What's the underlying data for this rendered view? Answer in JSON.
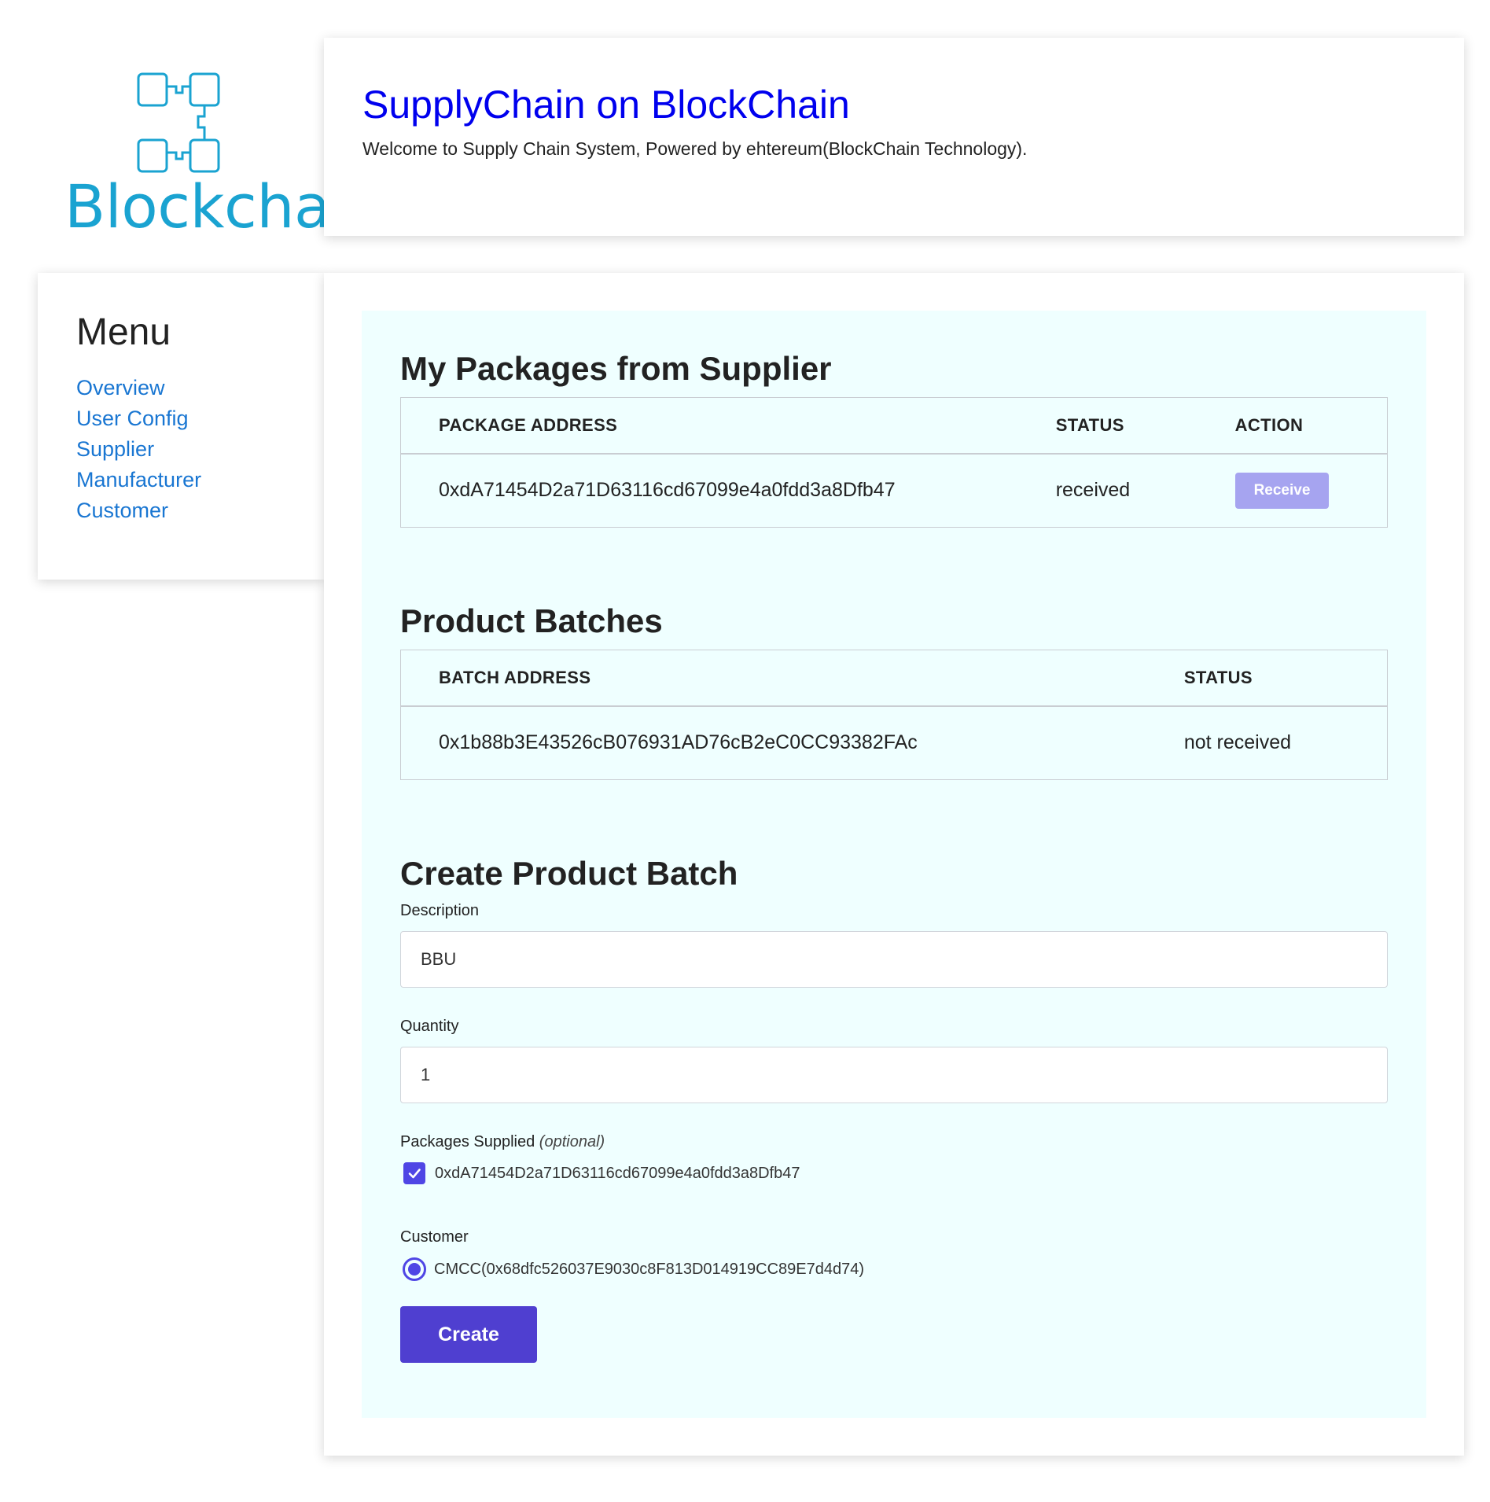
{
  "logo": {
    "text": "Blockchain",
    "color": "#1aa3d1"
  },
  "header": {
    "title": "SupplyChain on BlockChain",
    "subtitle": "Welcome to Supply Chain System, Powered by ehtereum(BlockChain Technology)."
  },
  "menu": {
    "title": "Menu",
    "items": [
      "Overview",
      "User Config",
      "Supplier",
      "Manufacturer",
      "Customer"
    ]
  },
  "packages": {
    "title": "My Packages from Supplier",
    "headers": [
      "PACKAGE ADDRESS",
      "STATUS",
      "ACTION"
    ],
    "rows": [
      {
        "address": "0xdA71454D2a71D63116cd67099e4a0fdd3a8Dfb47",
        "status": "received",
        "action": "Receive"
      }
    ]
  },
  "batches": {
    "title": "Product Batches",
    "headers": [
      "BATCH ADDRESS",
      "STATUS"
    ],
    "rows": [
      {
        "address": "0x1b88b3E43526cB076931AD76cB2eC0CC93382FAc",
        "status": "not received"
      }
    ]
  },
  "create_form": {
    "title": "Create Product Batch",
    "description_label": "Description",
    "description_value": "BBU",
    "quantity_label": "Quantity",
    "quantity_value": "1",
    "packages_label": "Packages Supplied",
    "packages_optional": "(optional)",
    "package_option": "0xdA71454D2a71D63116cd67099e4a0fdd3a8Dfb47",
    "package_checked": true,
    "customer_label": "Customer",
    "customer_option": "CMCC(0x68dfc526037E9030c8F813D014919CC89E7d4d74)",
    "customer_selected": true,
    "create_label": "Create"
  },
  "colors": {
    "title_link": "#0000ee",
    "menu_link": "#1976d2",
    "primary": "#4f46e5",
    "panel_bg": "#efffff"
  }
}
